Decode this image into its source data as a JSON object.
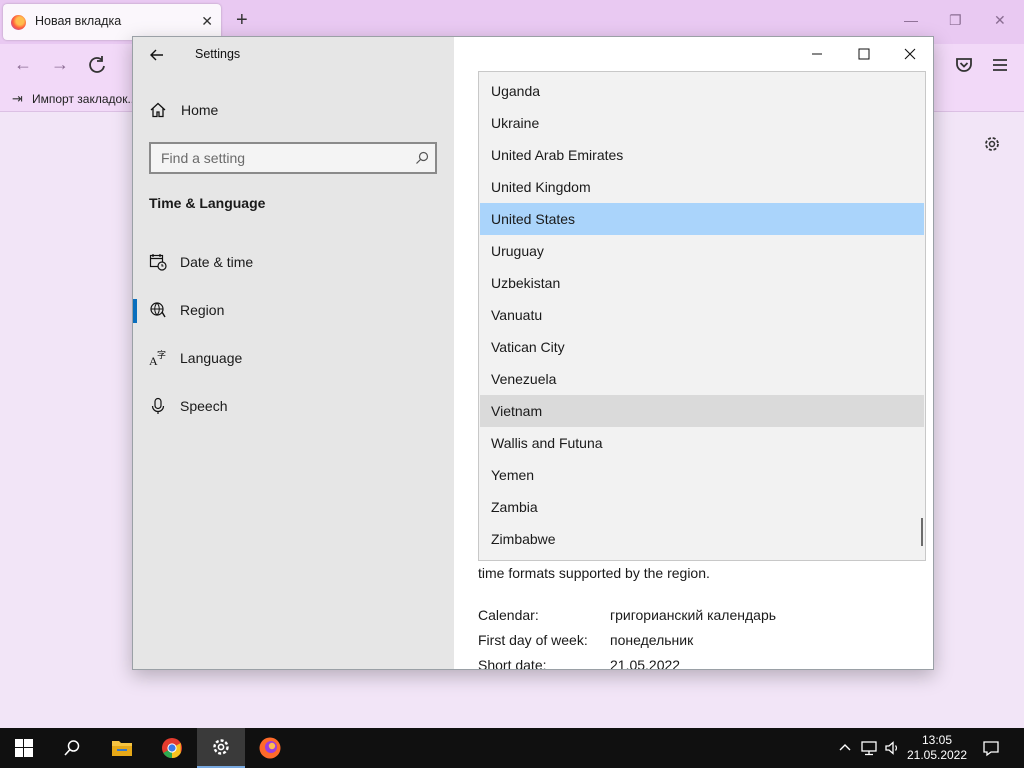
{
  "browser": {
    "tab_title": "Новая вкладка",
    "bookmark_import_label": "Импорт закладок..."
  },
  "settings": {
    "window_title": "Settings",
    "sidebar": {
      "home_label": "Home",
      "search_placeholder": "Find a setting",
      "section_title": "Time & Language",
      "items": [
        {
          "label": "Date & time",
          "icon": "calendar-clock-icon"
        },
        {
          "label": "Region",
          "icon": "globe-icon",
          "selected": true
        },
        {
          "label": "Language",
          "icon": "language-icon"
        },
        {
          "label": "Speech",
          "icon": "microphone-icon"
        }
      ]
    },
    "country_dropdown": {
      "selected": "United States",
      "hovered": "Vietnam",
      "options": [
        "Uganda",
        "Ukraine",
        "United Arab Emirates",
        "United Kingdom",
        "United States",
        "Uruguay",
        "Uzbekistan",
        "Vanuatu",
        "Vatican City",
        "Venezuela",
        "Vietnam",
        "Wallis and Futuna",
        "Yemen",
        "Zambia",
        "Zimbabwe"
      ]
    },
    "region_format": {
      "description_tail": "time formats supported by the region.",
      "calendar_label": "Calendar:",
      "calendar_value": "григорианский календарь",
      "first_day_label": "First day of week:",
      "first_day_value": "понедельник",
      "short_date_label": "Short date:",
      "short_date_value": "21.05.2022"
    }
  },
  "taskbar": {
    "time": "13:05",
    "date": "21.05.2022"
  },
  "colors": {
    "selection_blue": "#aad4fb",
    "hover_gray": "#dadada",
    "accent": "#0a6ebd",
    "firefox_tabbar": "#e9c9f2"
  }
}
